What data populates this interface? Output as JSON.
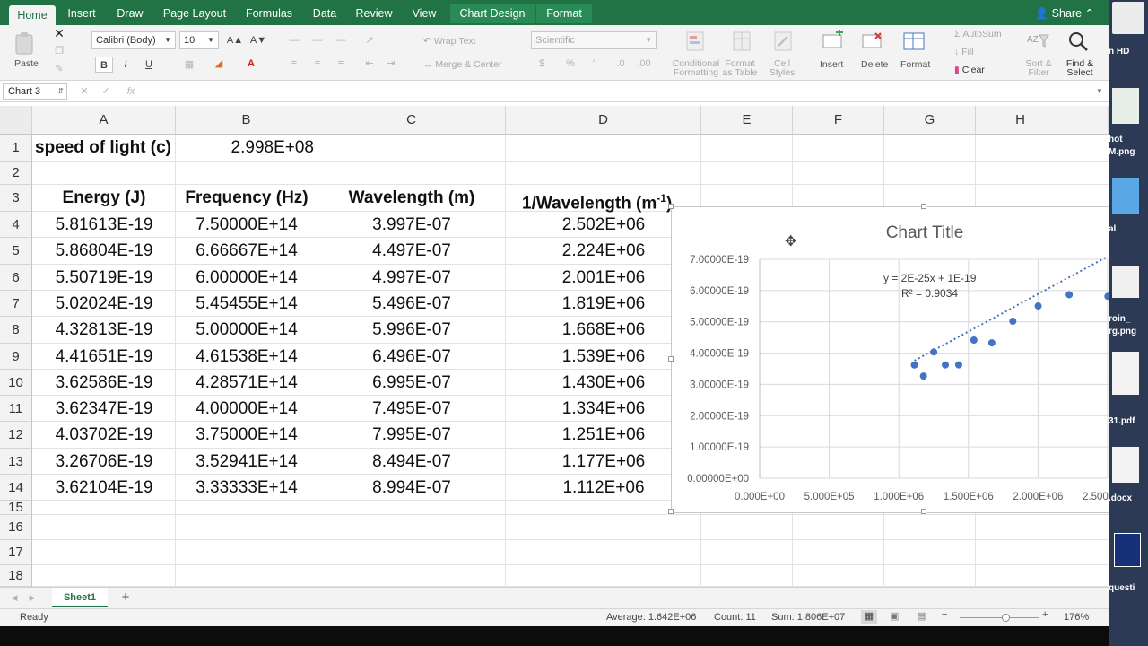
{
  "ribbon_tabs": [
    "Home",
    "Insert",
    "Draw",
    "Page Layout",
    "Formulas",
    "Data",
    "Review",
    "View",
    "Chart Design",
    "Format"
  ],
  "share_label": "Share",
  "ribbon": {
    "paste": "Paste",
    "font_name": "Calibri (Body)",
    "font_size": "10",
    "bold": "B",
    "italic": "I",
    "underline": "U",
    "wrap_text": "Wrap Text",
    "merge_center": "Merge & Center",
    "number_format": "Scientific",
    "conditional_formatting": [
      "Conditional",
      "Formatting"
    ],
    "format_as_table": [
      "Format",
      "as Table"
    ],
    "cell_styles": [
      "Cell",
      "Styles"
    ],
    "insert": "Insert",
    "delete": "Delete",
    "format": "Format",
    "autosum": "AutoSum",
    "fill": "Fill",
    "clear": "Clear",
    "sort_filter": [
      "Sort &",
      "Filter"
    ],
    "find_select": [
      "Find &",
      "Select"
    ]
  },
  "formula_bar": {
    "name_box": "Chart 3",
    "fx": "fx"
  },
  "columns": [
    "A",
    "B",
    "C",
    "D",
    "E",
    "F",
    "G",
    "H"
  ],
  "rows": [
    "1",
    "2",
    "3",
    "4",
    "5",
    "6",
    "7",
    "8",
    "9",
    "10",
    "11",
    "12",
    "13",
    "14",
    "15",
    "16",
    "17",
    "18"
  ],
  "sheet": {
    "a1": "speed of light (c)",
    "b1": "2.998E+08",
    "headers": [
      "Energy (J)",
      "Frequency (Hz)",
      "Wavelength (m)",
      "1/Wavelength (m"
    ],
    "header_sup": "-1",
    "header_close": ")",
    "data": [
      [
        "5.81613E-19",
        "7.50000E+14",
        "3.997E-07",
        "2.502E+06"
      ],
      [
        "5.86804E-19",
        "6.66667E+14",
        "4.497E-07",
        "2.224E+06"
      ],
      [
        "5.50719E-19",
        "6.00000E+14",
        "4.997E-07",
        "2.001E+06"
      ],
      [
        "5.02024E-19",
        "5.45455E+14",
        "5.496E-07",
        "1.819E+06"
      ],
      [
        "4.32813E-19",
        "5.00000E+14",
        "5.996E-07",
        "1.668E+06"
      ],
      [
        "4.41651E-19",
        "4.61538E+14",
        "6.496E-07",
        "1.539E+06"
      ],
      [
        "3.62586E-19",
        "4.28571E+14",
        "6.995E-07",
        "1.430E+06"
      ],
      [
        "3.62347E-19",
        "4.00000E+14",
        "7.495E-07",
        "1.334E+06"
      ],
      [
        "4.03702E-19",
        "3.75000E+14",
        "7.995E-07",
        "1.251E+06"
      ],
      [
        "3.26706E-19",
        "3.52941E+14",
        "8.494E-07",
        "1.177E+06"
      ],
      [
        "3.62104E-19",
        "3.33333E+14",
        "8.994E-07",
        "1.112E+06"
      ]
    ]
  },
  "chart_data": {
    "type": "scatter",
    "title": "Chart Title",
    "trendline_equation": "y = 2E-25x + 1E-19",
    "r_squared": "R² = 0.9034",
    "x": [
      2502000,
      2224000,
      2001000,
      1819000,
      1668000,
      1539000,
      1430000,
      1334000,
      1251000,
      1177000,
      1112000
    ],
    "y": [
      5.81613e-19,
      5.86804e-19,
      5.50719e-19,
      5.02024e-19,
      4.32813e-19,
      4.41651e-19,
      3.62586e-19,
      3.62347e-19,
      4.03702e-19,
      3.26706e-19,
      3.62104e-19
    ],
    "xlim": [
      0,
      2500000
    ],
    "ylim": [
      0,
      7e-19
    ],
    "x_ticks": [
      "0.000E+00",
      "5.000E+05",
      "1.000E+06",
      "1.500E+06",
      "2.000E+06",
      "2.500E+06"
    ],
    "y_ticks": [
      "0.00000E+00",
      "1.00000E-19",
      "2.00000E-19",
      "3.00000E-19",
      "4.00000E-19",
      "5.00000E-19",
      "6.00000E-19",
      "7.00000E-19"
    ],
    "trendline": {
      "slope": 2.4e-25,
      "intercept": 1.09e-19,
      "style": "dotted"
    },
    "grid": true,
    "marker_color": "#4472c4"
  },
  "sheet_tab": "Sheet1",
  "status": {
    "ready": "Ready",
    "average": "Average: 1.642E+06",
    "count": "Count: 11",
    "sum": "Sum: 1.806E+07",
    "zoom": "176%"
  },
  "desktop_labels": [
    "n HD",
    "hot",
    "M.png",
    "al",
    "roin_",
    "rg.png",
    "31.pdf",
    ".docx",
    "questi"
  ],
  "colors": {
    "excel_green": "#217346",
    "marker": "#4472c4"
  }
}
